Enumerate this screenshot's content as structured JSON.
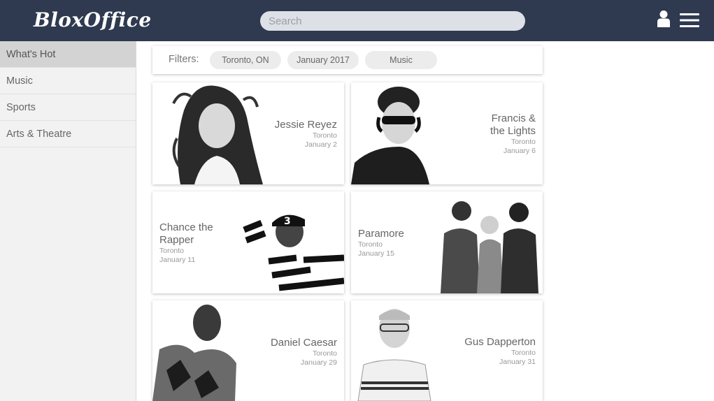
{
  "header": {
    "logo_text": "BloxOffice",
    "search_placeholder": "Search",
    "bg_color": "#2f3a50"
  },
  "sidebar": {
    "items": [
      {
        "label": "What's Hot",
        "active": true
      },
      {
        "label": "Music",
        "active": false
      },
      {
        "label": "Sports",
        "active": false
      },
      {
        "label": "Arts & Theatre",
        "active": false
      }
    ]
  },
  "filters": {
    "label": "Filters:",
    "chips": [
      "Toronto, ON",
      "January 2017",
      "Music"
    ]
  },
  "events": [
    {
      "name": "Jessie Reyez",
      "city": "Toronto",
      "date": "January 2"
    },
    {
      "name": "Francis & the Lights",
      "city": "Toronto",
      "date": "January 6"
    },
    {
      "name": "Chance the Rapper",
      "city": "Toronto",
      "date": "January 11"
    },
    {
      "name": "Paramore",
      "city": "Toronto",
      "date": "January 15"
    },
    {
      "name": "Daniel Caesar",
      "city": "Toronto",
      "date": "January 29"
    },
    {
      "name": "Gus Dapperton",
      "city": "Toronto",
      "date": "January 31"
    }
  ]
}
